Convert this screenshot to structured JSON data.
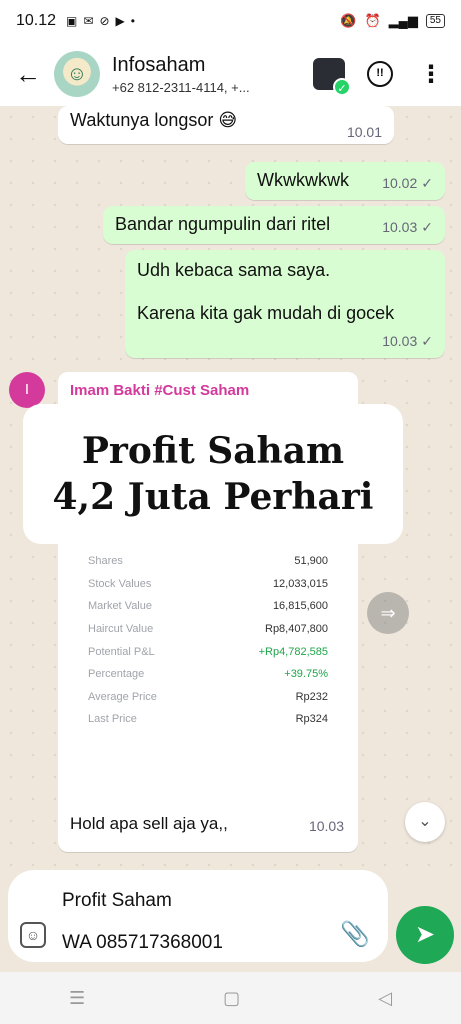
{
  "status": {
    "time": "10.12",
    "battery": "55"
  },
  "header": {
    "back_icon": "arrow-left-icon",
    "contact_name": "Infosaham",
    "contact_detail": "+62 812-2311-4114, +..."
  },
  "messages": [
    {
      "dir": "in",
      "text": "Waktunya longsor 😅",
      "time": "10.01"
    },
    {
      "dir": "out",
      "text": "Wkwkwkwk",
      "time": "10.02",
      "status": "✓"
    },
    {
      "dir": "out",
      "text": "Bandar ngumpulin dari ritel",
      "time": "10.03",
      "status": "✓"
    },
    {
      "dir": "out",
      "text_line1": "Udh kebaca sama saya.",
      "text_line2": "Karena kita gak mudah di gocek",
      "time": "10.03",
      "status": "✓"
    }
  ],
  "media_message": {
    "sender_initial": "I",
    "sender": "Imam Bakti #Cust Saham",
    "promo_line1": "Profit Saham",
    "promo_line2": "4,2 Juta Perhari",
    "stats": [
      {
        "label": "Shares",
        "value": "51,900"
      },
      {
        "label": "Stock Values",
        "value": "12,033,015"
      },
      {
        "label": "Market Value",
        "value": "16,815,600"
      },
      {
        "label": "Haircut Value",
        "value": "Rp8,407,800"
      },
      {
        "label": "Potential P&L",
        "value": "+Rp4,782,585"
      },
      {
        "label": "Percentage",
        "value": "+39.75%"
      },
      {
        "label": "Average Price",
        "value": "Rp232"
      },
      {
        "label": "Last Price",
        "value": "Rp324"
      }
    ],
    "caption": "Hold apa sell aja ya,,",
    "time": "10.03"
  },
  "composer": {
    "text_line1": "Profit Saham",
    "text_line2": "WA 085717368001"
  },
  "colors": {
    "accent": "#1fa855",
    "outgoing_bubble": "#d9fdd3",
    "sender_name": "#d33a9c",
    "positive": "#1fa64a"
  }
}
